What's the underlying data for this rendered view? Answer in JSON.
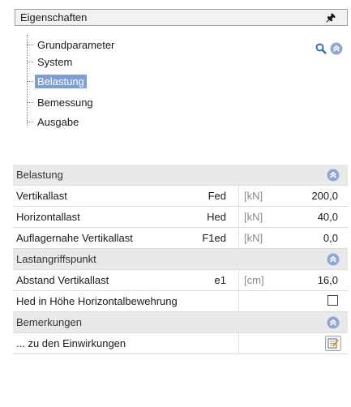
{
  "panel": {
    "title": "Eigenschaften",
    "pin_icon": "pin-icon"
  },
  "tree": {
    "items": [
      {
        "label": "Grundparameter",
        "selected": false
      },
      {
        "label": "System",
        "selected": false
      },
      {
        "label": "Belastung",
        "selected": true
      },
      {
        "label": "Bemessung",
        "selected": false
      },
      {
        "label": "Ausgabe",
        "selected": false
      }
    ]
  },
  "tools": {
    "search_icon": "search-icon",
    "collapse_icon": "collapse-up-icon"
  },
  "sections": {
    "belastung": {
      "title": "Belastung",
      "rows": [
        {
          "label": "Vertikallast",
          "symbol": "Fed",
          "unit": "[kN]",
          "value": "200,0"
        },
        {
          "label": "Horizontallast",
          "symbol": "Hed",
          "unit": "[kN]",
          "value": "40,0"
        },
        {
          "label": "Auflagernahe Vertikallast",
          "symbol": "F1ed",
          "unit": "[kN]",
          "value": "0,0"
        }
      ]
    },
    "lastangriffspunkt": {
      "title": "Lastangriffspunkt",
      "rows": [
        {
          "label": "Abstand Vertikallast",
          "symbol": "e1",
          "unit": "[cm]",
          "value": "16,0"
        }
      ],
      "checkbox_row": {
        "label": "Hed in Höhe Horizontalbewehrung",
        "checked": false
      }
    },
    "bemerkungen": {
      "title": "Bemerkungen",
      "row": {
        "label": "... zu den Einwirkungen",
        "button_icon": "edit-note-icon"
      }
    }
  },
  "colors": {
    "selection": "#7f9fd4",
    "section_bg": "#e9e9e9",
    "collapse_icon": "#8ea7d3"
  }
}
